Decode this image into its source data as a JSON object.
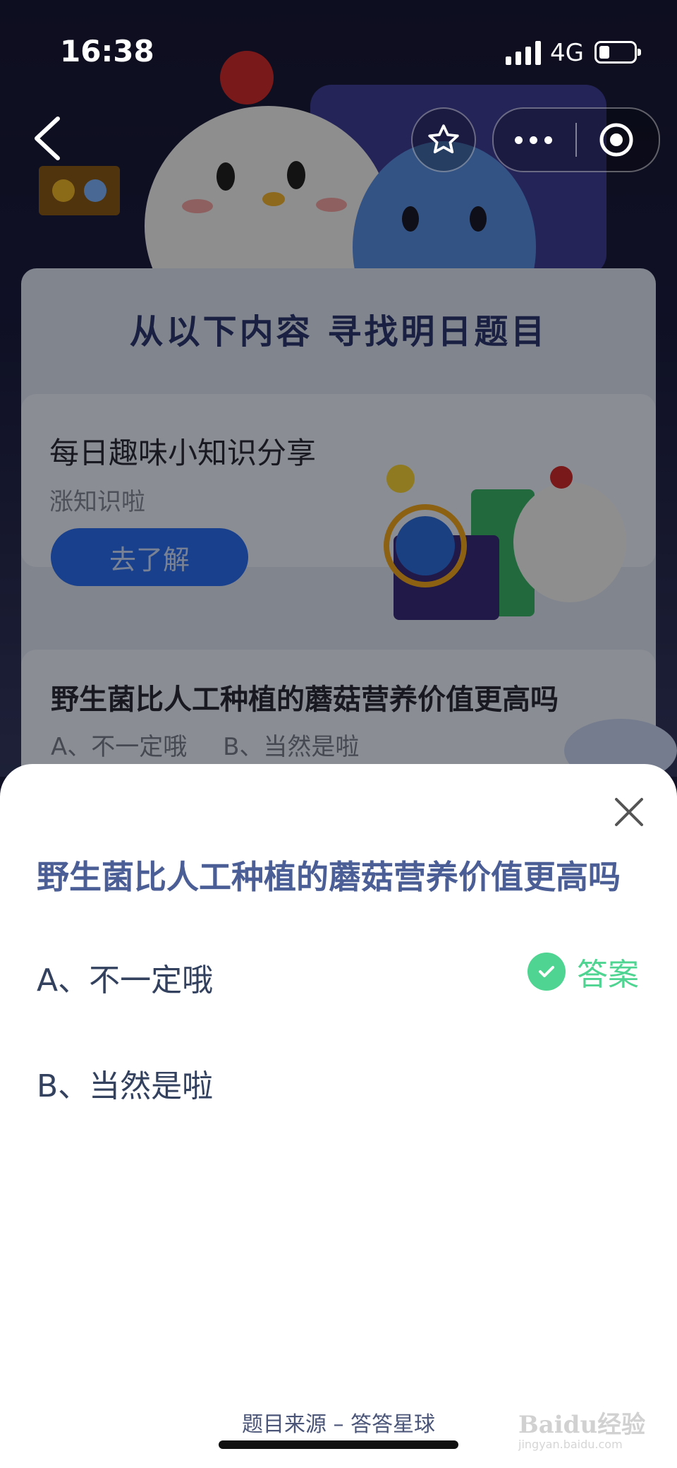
{
  "status_bar": {
    "time": "16:38",
    "network": "4G",
    "battery_level": 0.3
  },
  "nav": {
    "back_icon": "chevron-left-icon",
    "star_icon": "star-icon",
    "more_icon": "more-dots-icon",
    "target_icon": "target-icon"
  },
  "background": {
    "panel_title": "从以下内容  寻找明日题目",
    "card1": {
      "title": "每日趣味小知识分享",
      "subtitle": "涨知识啦",
      "button": "去了解"
    },
    "card2": {
      "question": "野生菌比人工种植的蘑菇营养价值更高吗",
      "options": "A、不一定哦  B、当然是啦"
    }
  },
  "sheet": {
    "question": "野生菌比人工种植的蘑菇营养价值更高吗",
    "options": [
      {
        "label": "A、不一定哦",
        "is_answer": true
      },
      {
        "label": "B、当然是啦",
        "is_answer": false
      }
    ],
    "answer_label": "答案",
    "source": "题目来源 – 答答星球",
    "accent_color": "#4fd491",
    "question_color": "#4b5e95"
  },
  "watermark": {
    "text": "Baidu经验",
    "url": "jingyan.baidu.com"
  }
}
